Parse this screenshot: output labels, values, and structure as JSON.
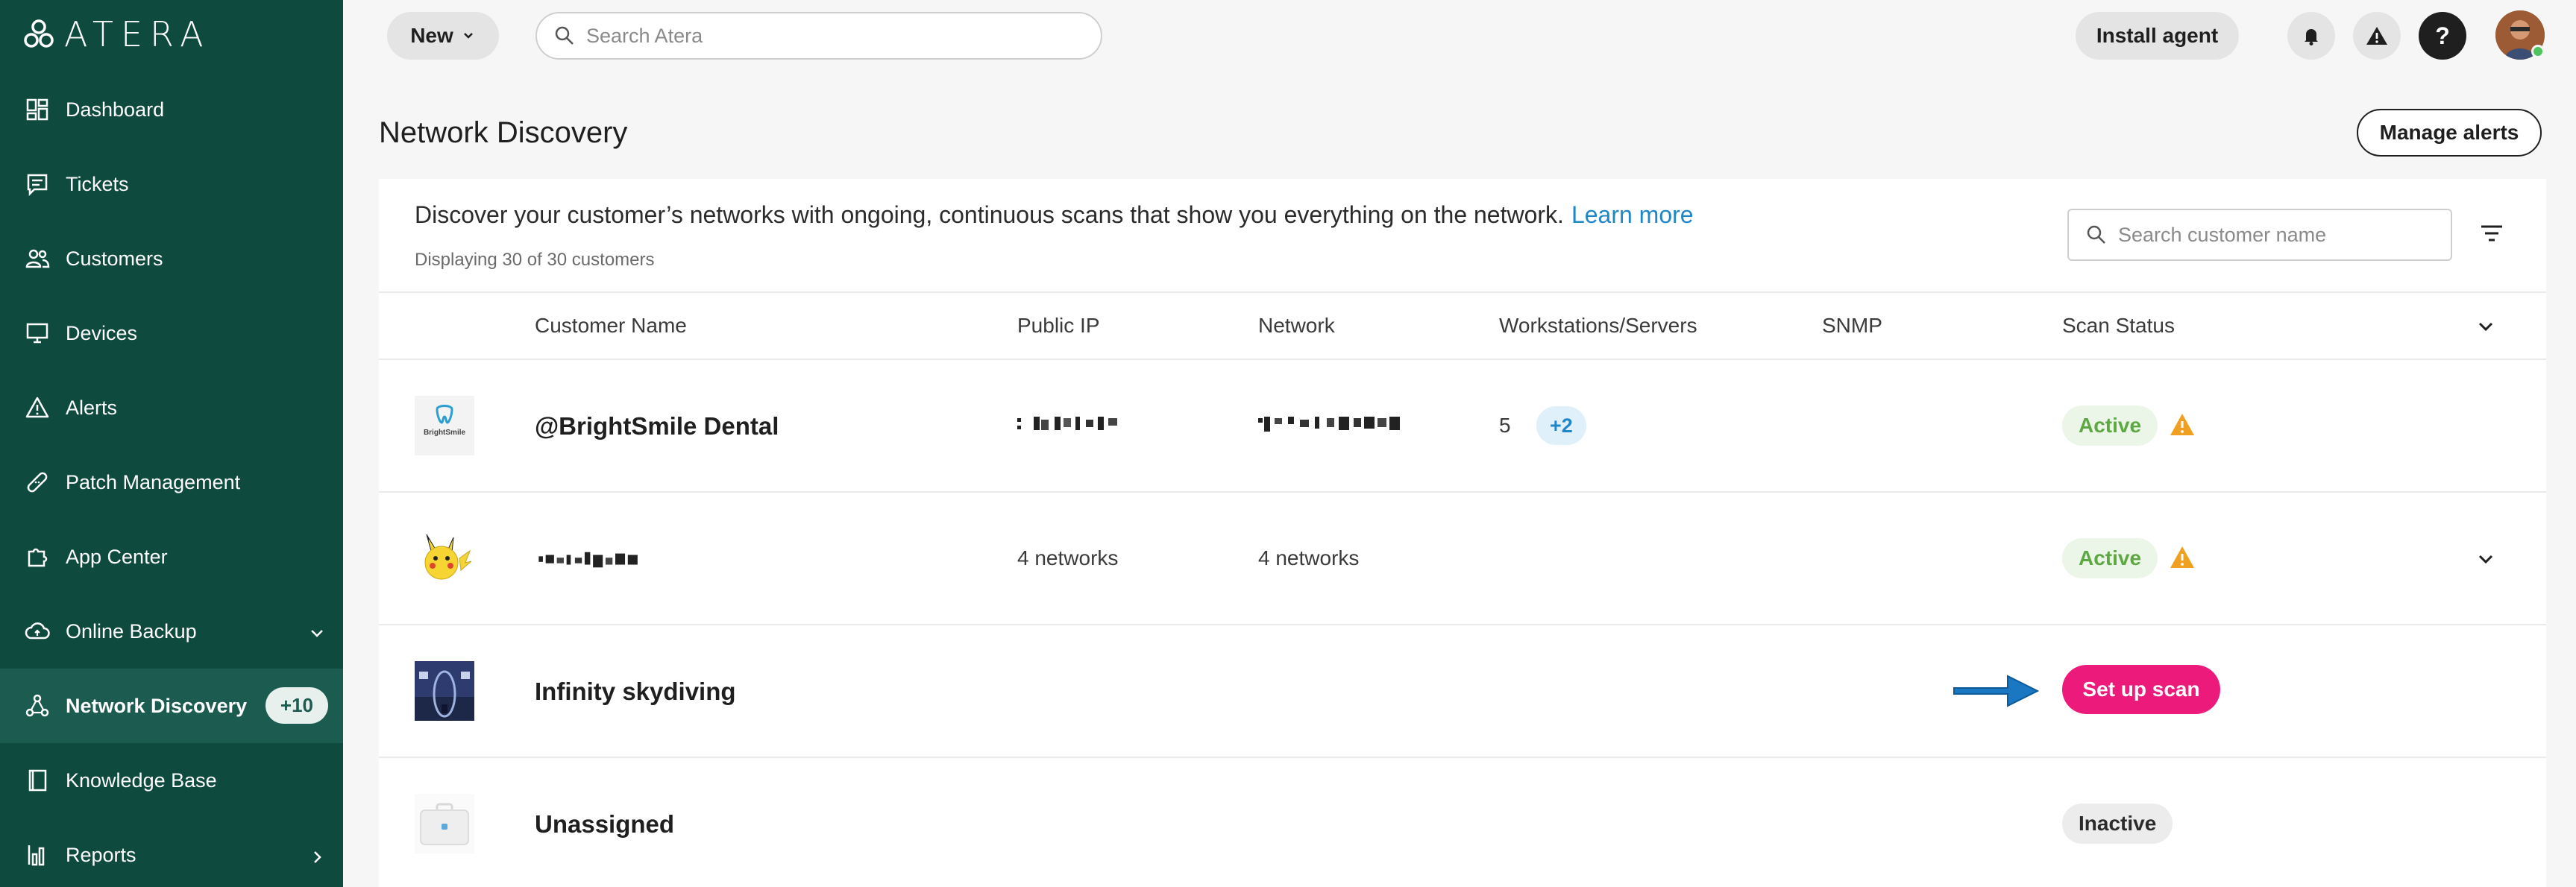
{
  "brand": {
    "name": "ATERA"
  },
  "sidebar": {
    "items": [
      {
        "label": "Dashboard",
        "icon": "dashboard-icon"
      },
      {
        "label": "Tickets",
        "icon": "tickets-icon"
      },
      {
        "label": "Customers",
        "icon": "customers-icon"
      },
      {
        "label": "Devices",
        "icon": "devices-icon"
      },
      {
        "label": "Alerts",
        "icon": "alerts-icon"
      },
      {
        "label": "Patch Management",
        "icon": "patch-icon"
      },
      {
        "label": "App Center",
        "icon": "app-center-icon"
      },
      {
        "label": "Online Backup",
        "icon": "cloud-backup-icon"
      },
      {
        "label": "Network Discovery",
        "icon": "network-icon",
        "badge": "+10",
        "active": true
      },
      {
        "label": "Knowledge Base",
        "icon": "book-icon"
      },
      {
        "label": "Reports",
        "icon": "reports-icon"
      }
    ]
  },
  "topbar": {
    "new_label": "New",
    "search_placeholder": "Search Atera",
    "install_label": "Install agent"
  },
  "page": {
    "title": "Network Discovery",
    "manage_alerts_label": "Manage alerts",
    "intro_text": "Discover your customer’s networks with ongoing, continuous scans that show you everything on the network.",
    "learn_more": "Learn more",
    "displaying": "Displaying 30 of 30 customers",
    "search_placeholder": "Search customer name"
  },
  "table": {
    "columns": [
      "Customer Name",
      "Public IP",
      "Network",
      "Workstations/Servers",
      "SNMP",
      "Scan Status"
    ],
    "rows": [
      {
        "name": "@BrightSmile Dental",
        "logo_text": "BrightSmile",
        "public_ip": "",
        "network": "",
        "workstations": "5",
        "extra": "+2",
        "status": "Active",
        "warning": true
      },
      {
        "name": "",
        "public_ip": "4 networks",
        "network": "4 networks",
        "status": "Active",
        "warning": true,
        "expandable": true
      },
      {
        "name": "Infinity skydiving",
        "action": "Set up scan"
      },
      {
        "name": "Unassigned",
        "status": "Inactive"
      }
    ]
  },
  "colors": {
    "sidebar_bg": "#0f4a3f",
    "accent_pink": "#ec1a7a",
    "link_blue": "#1f86c8",
    "active_green": "#5da843",
    "warning_orange": "#f0a020"
  }
}
